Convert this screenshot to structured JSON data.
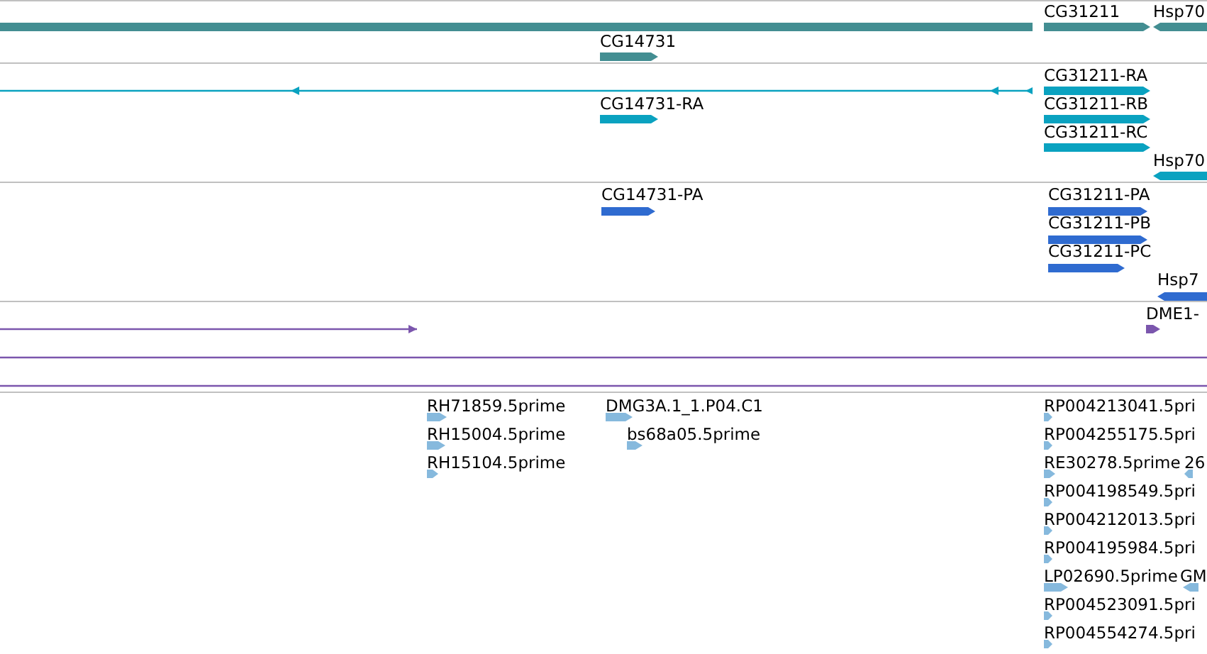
{
  "tracks": [
    {
      "color": "#438e92",
      "features": [
        {
          "kind": "bar"
        },
        {
          "kind": "bar",
          "label": "CG31211"
        },
        {
          "kind": "bar",
          "label": "Hsp70"
        },
        {
          "kind": "bar",
          "label": "CG14731"
        }
      ]
    },
    {
      "color": "#0aa2c0",
      "features": [
        {
          "kind": "line"
        },
        {
          "kind": "bar",
          "label": "CG14731-RA"
        },
        {
          "kind": "bar",
          "label": "CG31211-RA"
        },
        {
          "kind": "bar",
          "label": "CG31211-RB"
        },
        {
          "kind": "bar",
          "label": "CG31211-RC"
        },
        {
          "kind": "bar",
          "label": "Hsp70"
        }
      ]
    },
    {
      "color": "#2f6bd0",
      "features": [
        {
          "kind": "bar",
          "label": "CG14731-PA"
        },
        {
          "kind": "bar",
          "label": "CG31211-PA"
        },
        {
          "kind": "bar",
          "label": "CG31211-PB"
        },
        {
          "kind": "bar",
          "label": "CG31211-PC"
        },
        {
          "kind": "bar",
          "label": "Hsp7"
        }
      ]
    },
    {
      "color": "#7b56ad",
      "features": [
        {
          "kind": "bar",
          "label": "DME1-"
        },
        {
          "kind": "line"
        },
        {
          "kind": "line"
        },
        {
          "kind": "line"
        }
      ]
    },
    {
      "color": "#86b9dd",
      "features": [
        {
          "kind": "bar",
          "label": "RH71859.5prime"
        },
        {
          "kind": "bar",
          "label": "RH15004.5prime"
        },
        {
          "kind": "bar",
          "label": "RH15104.5prime"
        },
        {
          "kind": "bar",
          "label": "DMG3A.1_1.P04.C1"
        },
        {
          "kind": "bar",
          "label": "bs68a05.5prime"
        },
        {
          "kind": "bar",
          "label": "RP004213041.5pri"
        },
        {
          "kind": "bar",
          "label": "RP004255175.5pri"
        },
        {
          "kind": "bar",
          "label": "RE30278.5prime"
        },
        {
          "kind": "bar",
          "label": "26"
        },
        {
          "kind": "bar",
          "label": "RP004198549.5pri"
        },
        {
          "kind": "bar",
          "label": "RP004212013.5pri"
        },
        {
          "kind": "bar",
          "label": "RP004195984.5pri"
        },
        {
          "kind": "bar",
          "label": "LP02690.5prime"
        },
        {
          "kind": "bar",
          "label": "GM"
        },
        {
          "kind": "bar",
          "label": "RP004523091.5pri"
        },
        {
          "kind": "bar",
          "label": "RP004554274.5pri"
        }
      ]
    }
  ]
}
